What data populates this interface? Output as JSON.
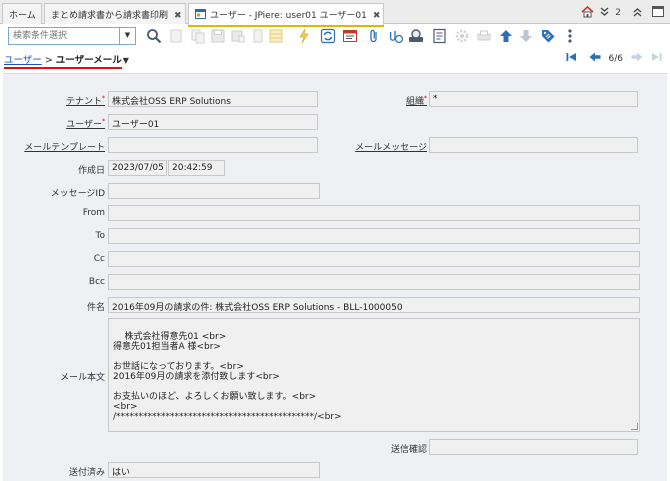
{
  "tabs": [
    {
      "label": "ホーム"
    },
    {
      "label": "まとめ請求書から請求書印刷",
      "close": "✖"
    },
    {
      "label": "ユーザー - JPiere: user01 ユーザー01",
      "close": "✖"
    }
  ],
  "tabbar": {
    "count": "2"
  },
  "toolbar": {
    "search_placeholder": "検索条件選択"
  },
  "breadcrumb": {
    "parent": "ユーザー",
    "separator": ">",
    "current": "ユーザーメール"
  },
  "record_nav": {
    "position": "6/6"
  },
  "form": {
    "tenant": {
      "label": "テナント",
      "value": "株式会社OSS ERP Solutions"
    },
    "org": {
      "label": "組織",
      "value": "*"
    },
    "user": {
      "label": "ユーザー",
      "value": "ユーザー01"
    },
    "mail_template": {
      "label": "メールテンプレート",
      "value": ""
    },
    "mail_message": {
      "label": "メールメッセージ",
      "value": ""
    },
    "created": {
      "label": "作成日",
      "date": "2023/07/05",
      "time": "20:42:59"
    },
    "message_id": {
      "label": "メッセージID",
      "value": ""
    },
    "from": {
      "label": "From",
      "value": ""
    },
    "to": {
      "label": "To",
      "value": ""
    },
    "cc": {
      "label": "Cc",
      "value": ""
    },
    "bcc": {
      "label": "Bcc",
      "value": ""
    },
    "subject": {
      "label": "件名",
      "value": "2016年09月の請求の件: 株式会社OSS ERP Solutions - BLL-1000050"
    },
    "body": {
      "label": "メール本文",
      "value": "株式会社得意先01 <br>\n得意先01担当者A 様<br>\n\nお世話になっております。<br>\n2016年09月の請求を添付致します<br>\n\nお支払いのほど、よろしくお願い致します。<br>\n<br>\n/********************************************/<br>"
    },
    "send_confirm": {
      "label": "送信確認",
      "value": ""
    },
    "sent": {
      "label": "送付済み",
      "value": "はい"
    }
  }
}
